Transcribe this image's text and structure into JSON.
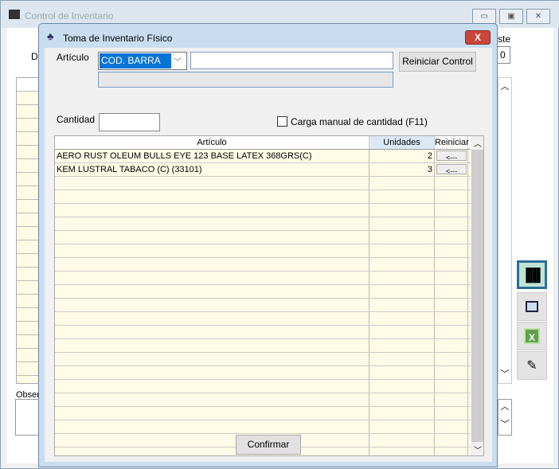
{
  "outer": {
    "title": "Control de Inventario",
    "label_d": "D",
    "label_ste": "ste",
    "value_0": "0",
    "label_obser": "Obser"
  },
  "dialog": {
    "title": "Toma de Inventario Físico",
    "close": "X",
    "articulo_label": "Artículo",
    "combo_value": "COD. BARRA",
    "search_value": "",
    "reset_button": "Reiniciar Control",
    "cantidad_label": "Cantidad",
    "cantidad_value": "",
    "manual_checkbox": "Carga manual de cantidad (F11)",
    "manual_checked": false,
    "columns": [
      "Artículo",
      "Unidades",
      "Reiniciar"
    ],
    "rows": [
      {
        "articulo": "AERO RUST OLEUM BULLS EYE 123 BASE LATEX 368GRS(C)",
        "unidades": "2",
        "reiniciar": "<---"
      },
      {
        "articulo": "KEM LUSTRAL TABACO (C) (33101)",
        "unidades": "3",
        "reiniciar": "<---"
      }
    ],
    "confirm_button": "Confirmar"
  },
  "side_icons": [
    "barcode-icon",
    "filter-report-icon",
    "excel-icon",
    "export-icon"
  ]
}
